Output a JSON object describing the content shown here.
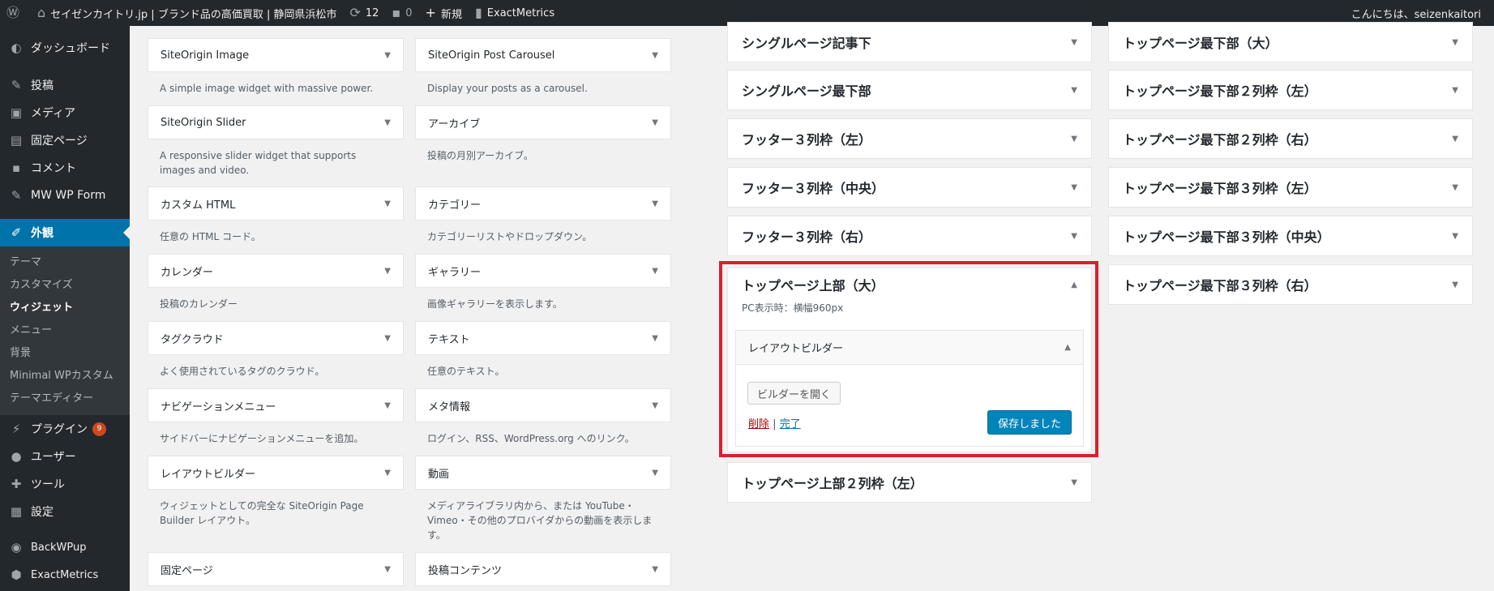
{
  "adminbar": {
    "site_name": "セイゼンカイトリ.jp | ブランド品の高価買取 | 静岡県浜松市",
    "updates_count": "12",
    "comments_count": "0",
    "new_label": "新規",
    "exactmetrics_label": "ExactMetrics",
    "greeting": "こんにちは、seizenkaitori"
  },
  "sidebar": {
    "items": [
      {
        "icon": "dashboard-icon",
        "label": "ダッシュボード"
      },
      {
        "icon": "pin-icon",
        "label": "投稿"
      },
      {
        "icon": "media-icon",
        "label": "メディア"
      },
      {
        "icon": "page-icon",
        "label": "固定ページ"
      },
      {
        "icon": "comment-icon",
        "label": "コメント"
      },
      {
        "icon": "pin-icon",
        "label": "MW WP Form"
      },
      {
        "icon": "brush-icon",
        "label": "外観"
      }
    ],
    "submenu": [
      "テーマ",
      "カスタマイズ",
      "ウィジェット",
      "メニュー",
      "背景",
      "Minimal WPカスタム",
      "テーマエディター"
    ],
    "items_after": [
      {
        "icon": "plugin-icon",
        "label": "プラグイン",
        "badge": "9"
      },
      {
        "icon": "user-icon",
        "label": "ユーザー"
      },
      {
        "icon": "wrench-icon",
        "label": "ツール"
      },
      {
        "icon": "settings-icon",
        "label": "設定"
      },
      {
        "icon": "backwpup-icon",
        "label": "BackWPup"
      },
      {
        "icon": "exactmetrics-icon",
        "label": "ExactMetrics"
      }
    ]
  },
  "widgets": [
    {
      "title": "SiteOrigin Image",
      "desc": "A simple image widget with massive power."
    },
    {
      "title": "SiteOrigin Post Carousel",
      "desc": "Display your posts as a carousel."
    },
    {
      "title": "SiteOrigin Slider",
      "desc": "A responsive slider widget that supports images and video."
    },
    {
      "title": "アーカイブ",
      "desc": "投稿の月別アーカイブ。"
    },
    {
      "title": "カスタム HTML",
      "desc": "任意の HTML コード。"
    },
    {
      "title": "カテゴリー",
      "desc": "カテゴリーリストやドロップダウン。"
    },
    {
      "title": "カレンダー",
      "desc": "投稿のカレンダー"
    },
    {
      "title": "ギャラリー",
      "desc": "画像ギャラリーを表示します。"
    },
    {
      "title": "タグクラウド",
      "desc": "よく使用されているタグのクラウド。"
    },
    {
      "title": "テキスト",
      "desc": "任意のテキスト。"
    },
    {
      "title": "ナビゲーションメニュー",
      "desc": "サイドバーにナビゲーションメニューを追加。"
    },
    {
      "title": "メタ情報",
      "desc": "ログイン、RSS、WordPress.org へのリンク。"
    },
    {
      "title": "レイアウトビルダー",
      "desc": "ウィジェットとしての完全な SiteOrigin Page Builder レイアウト。"
    },
    {
      "title": "動画",
      "desc": "メディアライブラリ内から、または YouTube・Vimeo・その他のプロバイダからの動画を表示します。"
    },
    {
      "title": "固定ページ",
      "desc": ""
    },
    {
      "title": "投稿コンテンツ",
      "desc": ""
    }
  ],
  "areas_col1": [
    "シングルページ記事下",
    "シングルページ最下部",
    "フッター３列枠（左）",
    "フッター３列枠（中央）",
    "フッター３列枠（右）"
  ],
  "areas_col1_after": [
    "トップページ上部２列枠（左）"
  ],
  "areas_col2": [
    "トップページ最下部（大）",
    "トップページ最下部２列枠（左）",
    "トップページ最下部２列枠（右）",
    "トップページ最下部３列枠（左）",
    "トップページ最下部３列枠（中央）",
    "トップページ最下部３列枠（右）"
  ],
  "expanded_area": {
    "title": "トップページ上部（大）",
    "desc": "PC表示時：横幅960px",
    "widget_title": "レイアウトビルダー",
    "open_builder": "ビルダーを開く",
    "delete_label": "削除",
    "separator": "|",
    "done_label": "完了",
    "saved_label": "保存しました"
  },
  "colors": {
    "adminbar_bg": "#23282d",
    "accent": "#0073aa",
    "primary_button": "#0085ba",
    "highlight": "#d9202b"
  }
}
